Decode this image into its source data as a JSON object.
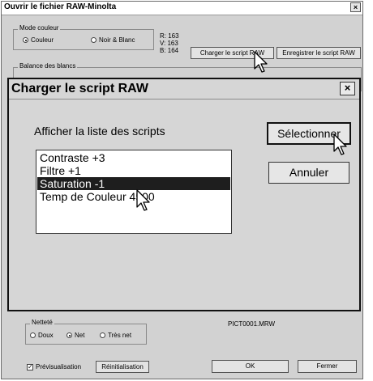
{
  "window": {
    "title": "Ouvrir le fichier RAW-Minolta",
    "close_glyph": "×"
  },
  "color_mode": {
    "label": "Mode couleur",
    "options": [
      {
        "label": "Couleur",
        "selected": true
      },
      {
        "label": "Noir & Blanc",
        "selected": false
      }
    ]
  },
  "rgb": {
    "r": "R: 163",
    "v": "V: 163",
    "b": "B: 164"
  },
  "top_buttons": {
    "load_script": "Charger le script RAW",
    "save_script": "Enregistrer le script RAW"
  },
  "white_balance": {
    "label": "Balance des blancs"
  },
  "sharpness": {
    "label": "Netteté",
    "options": [
      {
        "label": "Doux",
        "selected": false
      },
      {
        "label": "Net",
        "selected": true
      },
      {
        "label": "Très net",
        "selected": false
      }
    ]
  },
  "filename": "PICT0001.MRW",
  "preview": {
    "label": "Prévisualisation",
    "checked": true,
    "check_glyph": "✓"
  },
  "reset_button": "Réinitialisation",
  "ok_button": "OK",
  "close_button": "Fermer",
  "dialog": {
    "title": "Charger le script RAW",
    "close_glyph": "×",
    "list_label": "Afficher la liste des scripts",
    "scripts": [
      {
        "label": "Contraste +3",
        "selected": false
      },
      {
        "label": "Filtre +1",
        "selected": false
      },
      {
        "label": "Saturation -1",
        "selected": true
      },
      {
        "label": "Temp de Couleur 4500",
        "selected": false
      }
    ],
    "select_button": "Sélectionner",
    "cancel_button": "Annuler"
  },
  "cursors": [
    "arrow-cursor",
    "arrow-cursor",
    "arrow-cursor"
  ]
}
